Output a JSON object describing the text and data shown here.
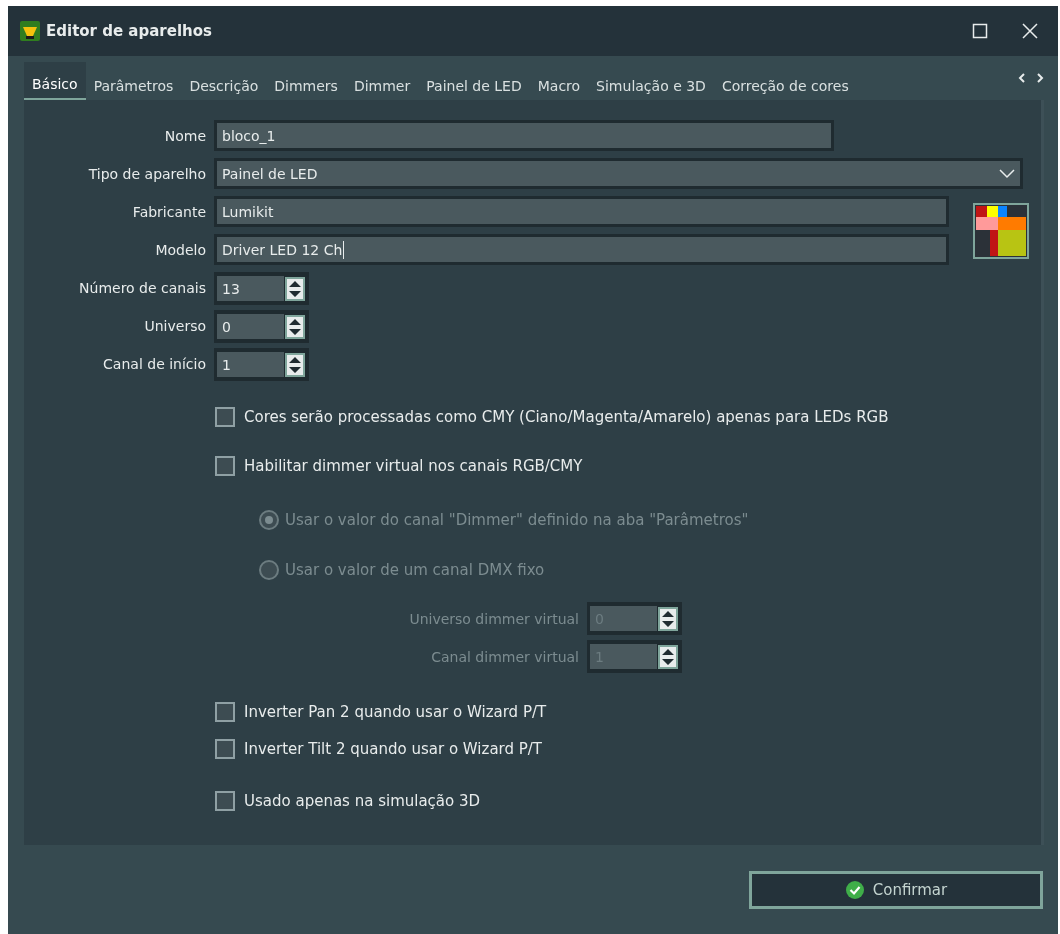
{
  "window": {
    "title": "Editor de aparelhos"
  },
  "tabs": [
    {
      "label": "Básico",
      "selected": true
    },
    {
      "label": "Parâmetros",
      "selected": false
    },
    {
      "label": "Descrição",
      "selected": false
    },
    {
      "label": "Dimmers",
      "selected": false
    },
    {
      "label": "Dimmer",
      "selected": false
    },
    {
      "label": "Painel de LED",
      "selected": false
    },
    {
      "label": "Macro",
      "selected": false
    },
    {
      "label": "Simulação e 3D",
      "selected": false
    },
    {
      "label": "Correção de cores",
      "selected": false
    }
  ],
  "fields": [
    {
      "kind": "text",
      "label": "Nome",
      "value": "bloco_1"
    },
    {
      "kind": "combo",
      "label": "Tipo de aparelho",
      "value": "Painel de LED"
    },
    {
      "kind": "text",
      "label": "Fabricante",
      "value": "Lumikit"
    },
    {
      "kind": "text",
      "label": "Modelo",
      "value": "Driver LED 12 Ch"
    },
    {
      "kind": "spin",
      "label": "Número de canais",
      "value": "13"
    },
    {
      "kind": "spin",
      "label": "Universo",
      "value": "0"
    },
    {
      "kind": "spin",
      "label": "Canal de início",
      "value": "1"
    }
  ],
  "color_options": [
    {
      "label": "Cores serão processadas como CMY (Ciano/Magenta/Amarelo) apenas para LEDs RGB",
      "checked": false
    },
    {
      "label": "Habilitar dimmer virtual nos canais RGB/CMY",
      "checked": false
    }
  ],
  "virtual_dimmer_source": [
    {
      "label": "Usar o valor do canal \"Dimmer\" definido na aba \"Parâmetros\"",
      "selected": true,
      "disabled": true
    },
    {
      "label": "Usar o valor de um canal DMX fixo",
      "selected": false,
      "disabled": true
    }
  ],
  "virtual_dimmer_fields": [
    {
      "label": "Universo dimmer virtual",
      "value": "0",
      "disabled": true
    },
    {
      "label": "Canal dimmer virtual",
      "value": "1",
      "disabled": true
    }
  ],
  "invert_options": [
    {
      "label": "Inverter Pan 2 quando usar o Wizard P/T",
      "checked": false
    },
    {
      "label": "Inverter Tilt 2 quando usar o Wizard P/T",
      "checked": false
    }
  ],
  "simulation_option": {
    "label": "Usado apenas na simulação 3D",
    "checked": false
  },
  "confirm_button": {
    "label": "Confirmar"
  }
}
